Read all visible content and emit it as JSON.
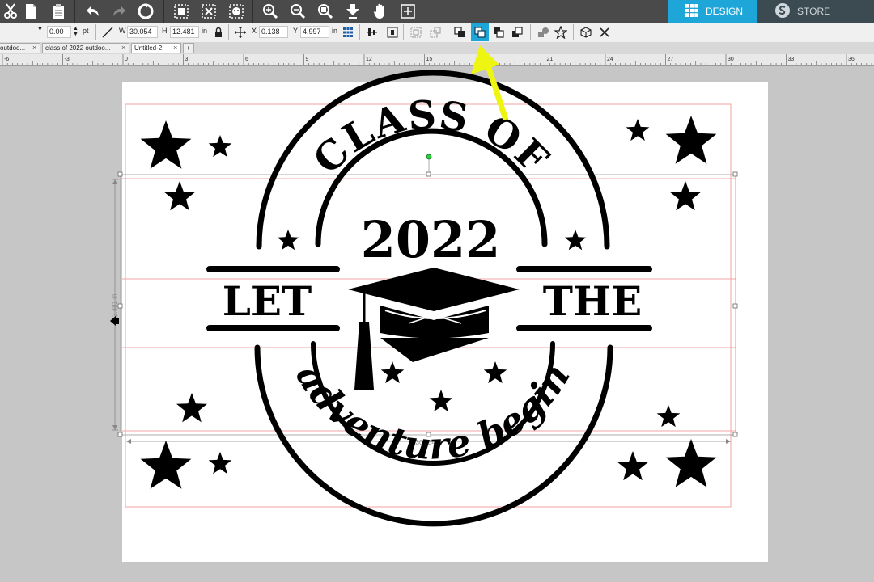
{
  "toolbar": {
    "tools": [
      {
        "name": "cut-icon"
      },
      {
        "name": "copy-icon"
      },
      {
        "name": "paste-icon"
      },
      {
        "name": "undo-icon"
      },
      {
        "name": "redo-icon"
      },
      {
        "name": "redraw-icon"
      },
      {
        "name": "select-icon"
      },
      {
        "name": "deselect-icon"
      },
      {
        "name": "edit-points-icon"
      },
      {
        "name": "zoom-in-icon"
      },
      {
        "name": "zoom-out-icon"
      },
      {
        "name": "zoom-select-icon"
      },
      {
        "name": "move-down-icon"
      },
      {
        "name": "pan-icon"
      },
      {
        "name": "fit-page-icon"
      }
    ],
    "design_tab_label": "DESIGN",
    "store_tab_label": "STORE",
    "accent_color": "#1fa6d9"
  },
  "properties": {
    "line_width_value": "0.00",
    "line_width_unit": "pt",
    "width_label": "W",
    "width_value": "30.054",
    "height_label": "H",
    "height_value": "12.481",
    "size_unit": "in",
    "x_label": "X",
    "x_value": "0.138",
    "y_label": "Y",
    "y_value": "4.997",
    "position_unit": "in"
  },
  "doc_tabs": [
    {
      "label": "outdoo..."
    },
    {
      "label": "class of 2022 outdoo..."
    },
    {
      "label": "Untitled-2"
    }
  ],
  "new_tab_label": "+",
  "ruler_labels": [
    "-6",
    "-3",
    "0",
    "3",
    "6",
    "9",
    "12",
    "15",
    "18",
    "21",
    "24",
    "27",
    "30",
    "33",
    "36"
  ],
  "design": {
    "top_text": "CLASS OF",
    "year_text": "2022",
    "left_text": "LET",
    "right_text": "THE",
    "bottom_text": "adventure begin"
  },
  "selection": {
    "width_readout": "30.054 in",
    "height_readout": "12.481 in"
  },
  "annotation": {
    "arrow_color": "#eef510"
  }
}
